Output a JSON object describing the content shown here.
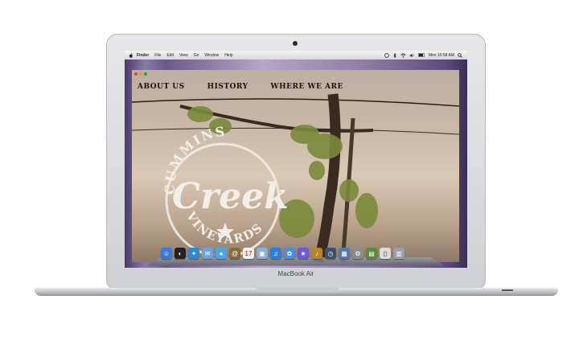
{
  "menubar": {
    "items": [
      "Finder",
      "File",
      "Edit",
      "View",
      "Go",
      "Window",
      "Help"
    ],
    "clock": "Mon 10:58 AM"
  },
  "website": {
    "nav": [
      "ABOUT US",
      "HISTORY",
      "WHERE WE ARE"
    ],
    "logo": {
      "top": "CUMMINS",
      "main": "Creek",
      "bottom": "VINEYARDS"
    }
  },
  "device": {
    "label": "MacBook Air"
  },
  "dock": {
    "icons": [
      "finder-icon",
      "dashboard-icon",
      "safari-icon",
      "mail-icon",
      "ichat-icon",
      "address-book-icon",
      "calendar-icon",
      "preview-icon",
      "itunes-icon",
      "iphoto-icon",
      "imovie-icon",
      "garageband-icon",
      "time-machine-icon",
      "spaces-icon",
      "system-preferences-icon",
      "documents-icon",
      "downloads-icon",
      "trash-icon"
    ]
  },
  "colors": {
    "menubar": "#e6e6e6",
    "nav_text": "#1a1410",
    "logo": "#f2efe9"
  }
}
